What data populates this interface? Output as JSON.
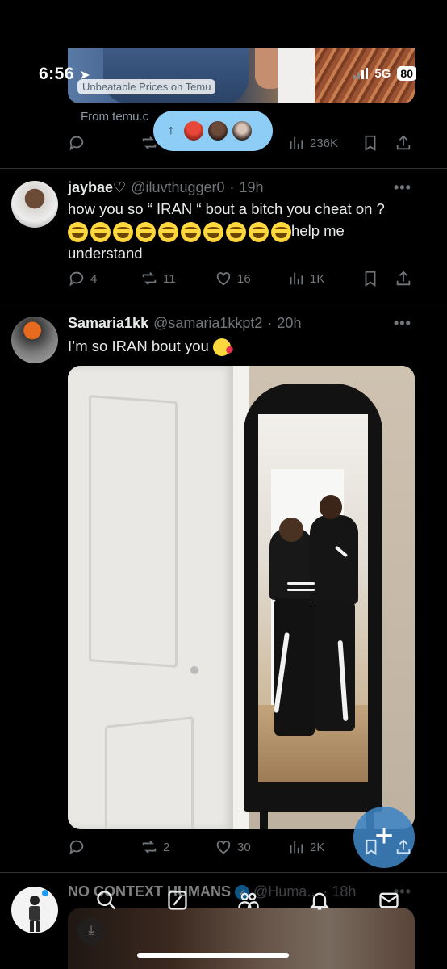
{
  "status_bar": {
    "time": "6:56",
    "network": "5G",
    "battery": "80"
  },
  "ad": {
    "label": "Unbeatable Prices on Temu",
    "from": "From temu.c"
  },
  "new_posts_pill": {
    "arrow": "↑"
  },
  "ad_actions": {
    "views": "236K"
  },
  "posts": [
    {
      "name": "jaybae♡",
      "handle": "@iluvthugger0",
      "time": "19h",
      "text_line1": "how you so “ IRAN “ bout a bitch you cheat on ?",
      "text_suffix": "help me",
      "text_line3": "understand",
      "emoji_count": 10,
      "replies": "4",
      "reposts": "11",
      "likes": "16",
      "views": "1K"
    },
    {
      "name": "Samaria1kk",
      "handle": "@samaria1kkpt2",
      "time": "20h",
      "text": "I’m so IRAN bout you",
      "replies": "",
      "reposts": "2",
      "likes": "30",
      "views": "2K"
    },
    {
      "name": "NO CONTEXT HUMANS",
      "handle": "@Huma...",
      "time": "18h"
    }
  ],
  "icons": {
    "reply": "reply-icon",
    "repost": "repost-icon",
    "like": "heart-icon",
    "views": "views-icon",
    "bookmark": "bookmark-icon",
    "share": "share-icon",
    "more": "more-icon"
  },
  "colors": {
    "accent": "#1d9bf0",
    "muted": "#71767b",
    "pill": "#8ecdf6"
  }
}
